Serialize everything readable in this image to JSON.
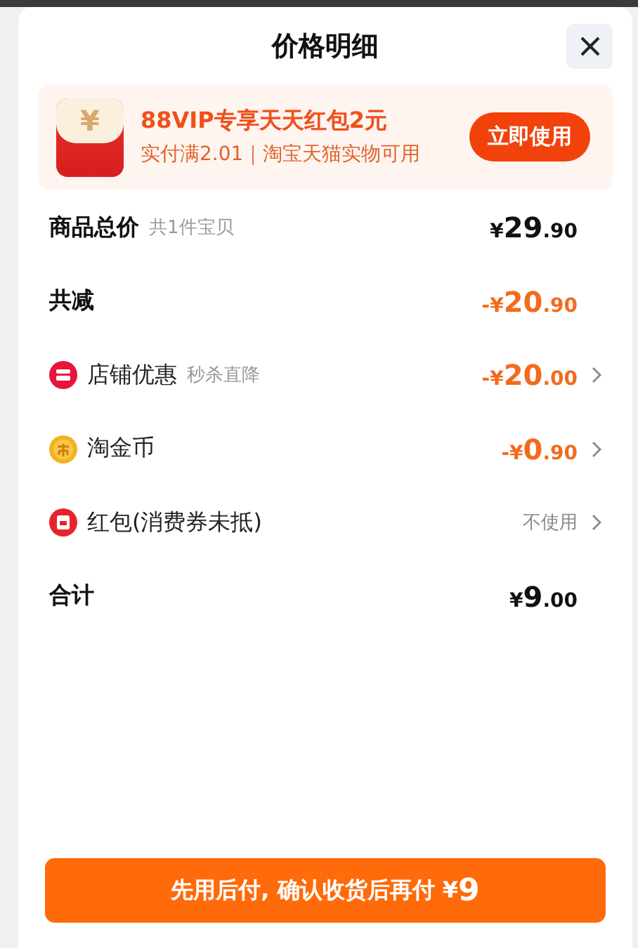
{
  "title": "价格明细",
  "promo": {
    "title": "88VIP专享天天红包2元",
    "subtitle": "实付满2.01｜淘宝天猫实物可用",
    "icon_glyph": "¥",
    "button": "立即使用"
  },
  "rows": [
    {
      "kind": "total",
      "label": "商品总价",
      "note": "共1件宝贝",
      "price": {
        "sign": "¥",
        "whole": "29",
        "fraction": ".90"
      }
    },
    {
      "kind": "reduction",
      "label": "共减",
      "price": {
        "sign": "-¥",
        "whole": "20",
        "fraction": ".90"
      }
    },
    {
      "kind": "shop",
      "label": "店铺优惠",
      "note": "秒杀直降",
      "price": {
        "sign": "-¥",
        "whole": "20",
        "fraction": ".00"
      }
    },
    {
      "kind": "coin",
      "label": "淘金币",
      "price": {
        "sign": "-¥",
        "whole": "0",
        "fraction": ".90"
      }
    },
    {
      "kind": "envelope",
      "label": "红包(消费券未抵)",
      "value": "不使用"
    },
    {
      "kind": "total",
      "label": "合计",
      "price": {
        "sign": "¥",
        "whole": "9",
        "fraction": ".00"
      }
    }
  ],
  "pay_button": {
    "label": "先用后付, 确认收货后再付 ",
    "sign": "¥",
    "amount": "9"
  }
}
